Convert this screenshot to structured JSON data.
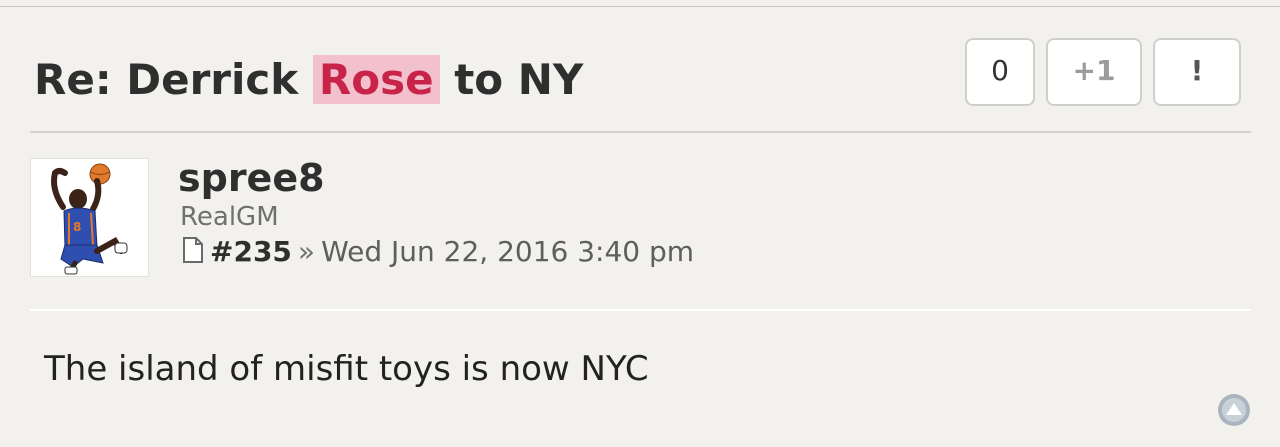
{
  "post": {
    "title_prefix": "Re: Derrick",
    "title_highlight": "Rose",
    "title_suffix": "to NY",
    "body": "The island of misfit toys is now NYC"
  },
  "vote_buttons": {
    "count": "0",
    "plus_one": "+1",
    "report": "!"
  },
  "author": {
    "username": "spree8",
    "rank": "RealGM"
  },
  "meta": {
    "post_number": "#235",
    "separator": "»",
    "date": "Wed Jun 22, 2016 3:40 pm"
  },
  "colors": {
    "highlight_bg": "#f3c0cd",
    "highlight_text": "#c8244a",
    "page_bg": "#f2f1ed"
  },
  "icons": {
    "post_link": "document-icon",
    "back_to_top": "arrow-up-circle-icon",
    "avatar": "basketball-player-avatar"
  }
}
